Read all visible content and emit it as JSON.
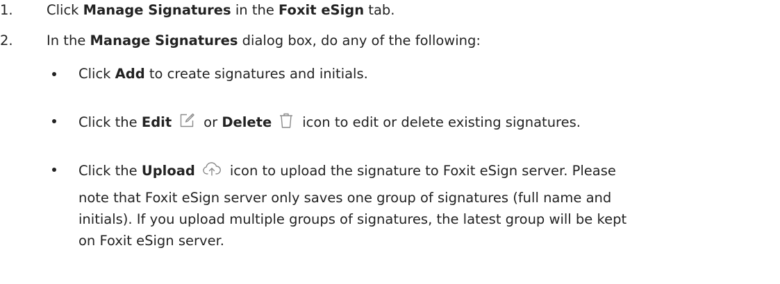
{
  "steps": [
    {
      "number": "1.",
      "parts": [
        "Click ",
        "Manage Signatures",
        " in the ",
        "Foxit eSign",
        " tab."
      ]
    },
    {
      "number": "2.",
      "parts": [
        "In the ",
        "Manage Signatures",
        " dialog box, do any of the following:"
      ]
    }
  ],
  "bullets": {
    "add": [
      "Click ",
      "Add",
      " to create signatures and initials."
    ],
    "edit_delete": [
      "Click the ",
      "Edit",
      "or ",
      "Delete",
      "icon to edit or delete existing signatures."
    ],
    "upload": [
      "Click the ",
      "Upload",
      "icon to upload the signature to Foxit eSign server. Please"
    ],
    "upload_continued": [
      "note that Foxit eSign server only saves one group of signatures (full name and",
      "initials). If you upload multiple groups of signatures, the latest group will be kept",
      "on Foxit eSign server."
    ]
  },
  "icons": {
    "edit": "edit-icon",
    "delete": "trash-icon",
    "upload": "cloud-upload-icon"
  },
  "colors": {
    "text": "#222222",
    "icon": "#8a8a8a"
  }
}
